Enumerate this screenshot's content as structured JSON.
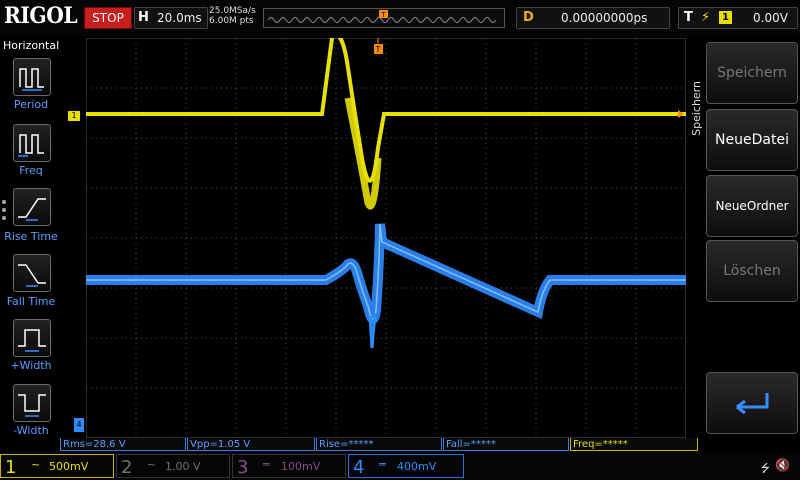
{
  "brand": "RIGOL",
  "run_state": "STOP",
  "horizontal": {
    "label": "H",
    "timebase": "20.0ms",
    "sample_rate": "25.0MSa/s",
    "points": "6.00M pts"
  },
  "delay": {
    "label": "D",
    "value": "0.00000000ps"
  },
  "trigger": {
    "label": "T",
    "source": "1",
    "level": "0.00V",
    "marker": "T"
  },
  "left_menu": {
    "title": "Horizontal",
    "items": [
      {
        "label": "Period",
        "icon": "period-icon"
      },
      {
        "label": "Freq",
        "icon": "freq-icon"
      },
      {
        "label": "Rise Time",
        "icon": "rise-time-icon"
      },
      {
        "label": "Fall Time",
        "icon": "fall-time-icon"
      },
      {
        "label": "+Width",
        "icon": "pos-width-icon"
      },
      {
        "label": "-Width",
        "icon": "neg-width-icon"
      }
    ]
  },
  "right_menu": {
    "title": "Speichern",
    "items": [
      {
        "label": "Speichern",
        "enabled": false
      },
      {
        "label": "NeueDatei",
        "enabled": true
      },
      {
        "label": "NeueOrdner",
        "enabled": true
      },
      {
        "label": "Löschen",
        "enabled": false
      },
      {
        "label": "",
        "icon": "enter-return-icon",
        "enabled": true
      }
    ]
  },
  "measurements": [
    {
      "text": "Rms=28.6 V",
      "channel": 4
    },
    {
      "text": "Vpp=1.05 V",
      "channel": 4
    },
    {
      "text": "Rise=*****",
      "channel": 4
    },
    {
      "text": "Fall=*****",
      "channel": 4
    },
    {
      "text": "Freq=*****",
      "channel": 1
    }
  ],
  "channels": [
    {
      "num": "1",
      "coupling": "~",
      "scale": "500mV",
      "color": "#e8e000",
      "active": true
    },
    {
      "num": "2",
      "coupling": "~",
      "scale": "1.00 V",
      "color": "#6a7a6a",
      "active": false
    },
    {
      "num": "3",
      "coupling": "═",
      "scale": "100mV",
      "color": "#8a4a8a",
      "active": false
    },
    {
      "num": "4",
      "coupling": "═",
      "scale": "400mV",
      "color": "#2f8cff",
      "active": true
    }
  ],
  "channel_markers": {
    "ch1": "1",
    "ch4": "4"
  },
  "colors": {
    "ch1": "#e8e000",
    "ch4": "#2f8cff",
    "trigger": "#ff8c00",
    "grid": "#555555",
    "stop": "#c81e1e"
  },
  "status_icons": [
    "usb-icon",
    "speaker-muted-icon"
  ]
}
